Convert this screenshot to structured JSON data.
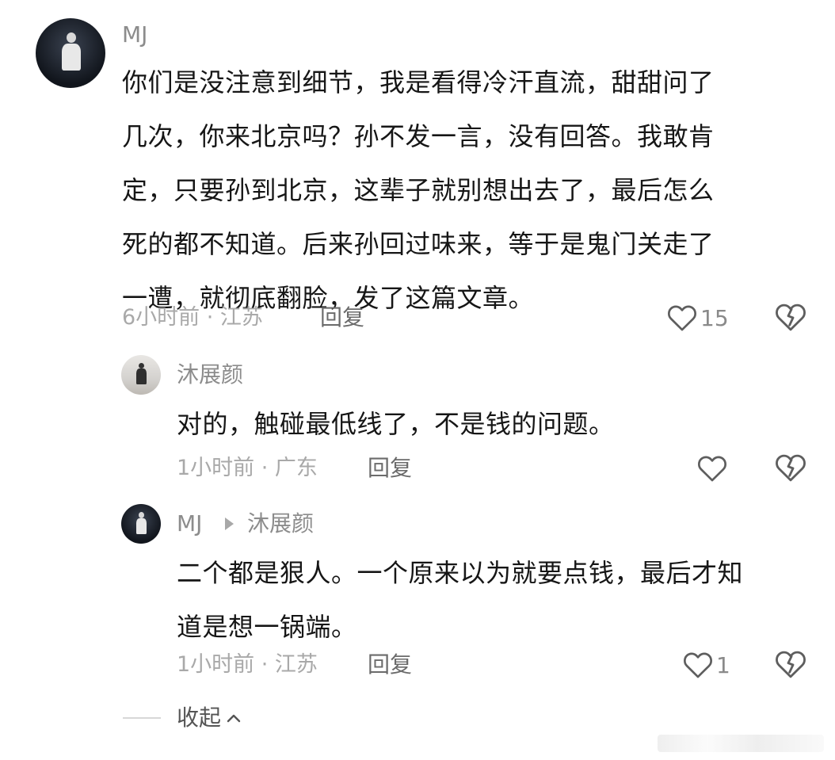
{
  "comments": [
    {
      "username": "MJ",
      "text": "你们是没注意到细节，我是看得冷汗直流，甜甜问了\n几次，你来北京吗？孙不发一言，没有回答。我敢肯\n定，只要孙到北京，这辈子就别想出去了，最后怎么\n死的都不知道。后来孙回过味来，等于是鬼门关走了\n一遭，就彻底翻脸，发了这篇文章。",
      "meta": "6小时前 · 江苏",
      "reply_label": "回复",
      "likes": "15"
    }
  ],
  "replies": [
    {
      "username": "沐展颜",
      "text": "对的，触碰最低线了，不是钱的问题。",
      "meta": "1小时前 · 广东",
      "reply_label": "回复",
      "likes": ""
    },
    {
      "username": "MJ",
      "reply_to": "沐展颜",
      "text": "二个都是狠人。一个原来以为就要点钱，最后才知\n道是想一锅端。",
      "meta": "1小时前 · 江苏",
      "reply_label": "回复",
      "likes": "1"
    }
  ],
  "collapse_label": "收起",
  "icons": {
    "like": "heart-outline-icon",
    "dislike": "broken-heart-icon",
    "collapse": "chevron-up-icon",
    "reply_pointer": "triangle-right-icon"
  },
  "colors": {
    "text": "#161616",
    "meta": "#a9a9a9",
    "username": "#8c8c8c",
    "icon": "#5e5e5e"
  }
}
